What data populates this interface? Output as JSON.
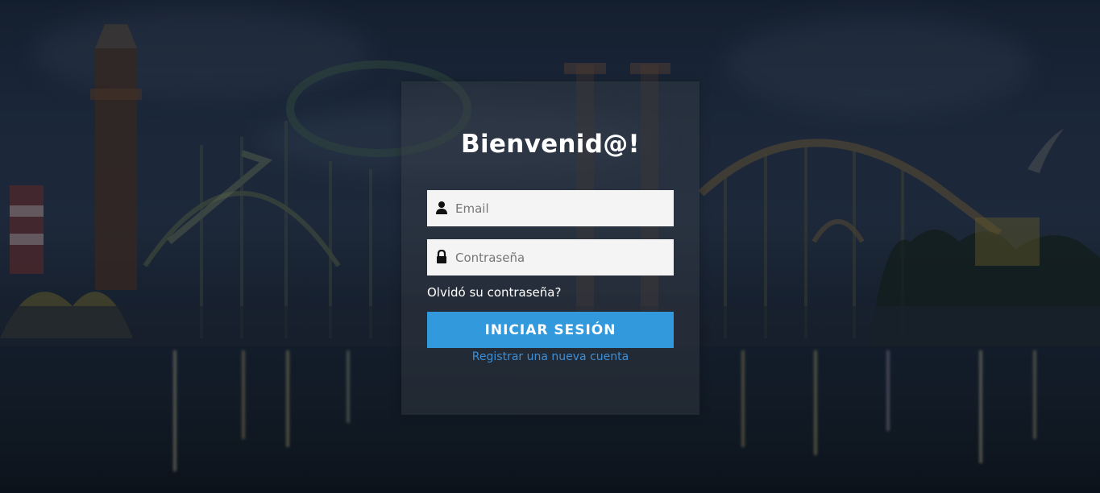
{
  "background": {
    "image": "amusement-park-night-photo",
    "overlay_color": "#080c14"
  },
  "login": {
    "title": "Bienvenid@!",
    "email_placeholder": "Email",
    "email_icon": "user-icon",
    "password_placeholder": "Contraseña",
    "password_icon": "lock-icon",
    "forgot_label": "Olvidó su contraseña?",
    "submit_label": "INICIAR SESIÓN",
    "register_label": "Registrar una nueva cuenta"
  },
  "colors": {
    "button": "#3399dd",
    "link": "#3d8fd6",
    "panel": "#3c424a"
  }
}
